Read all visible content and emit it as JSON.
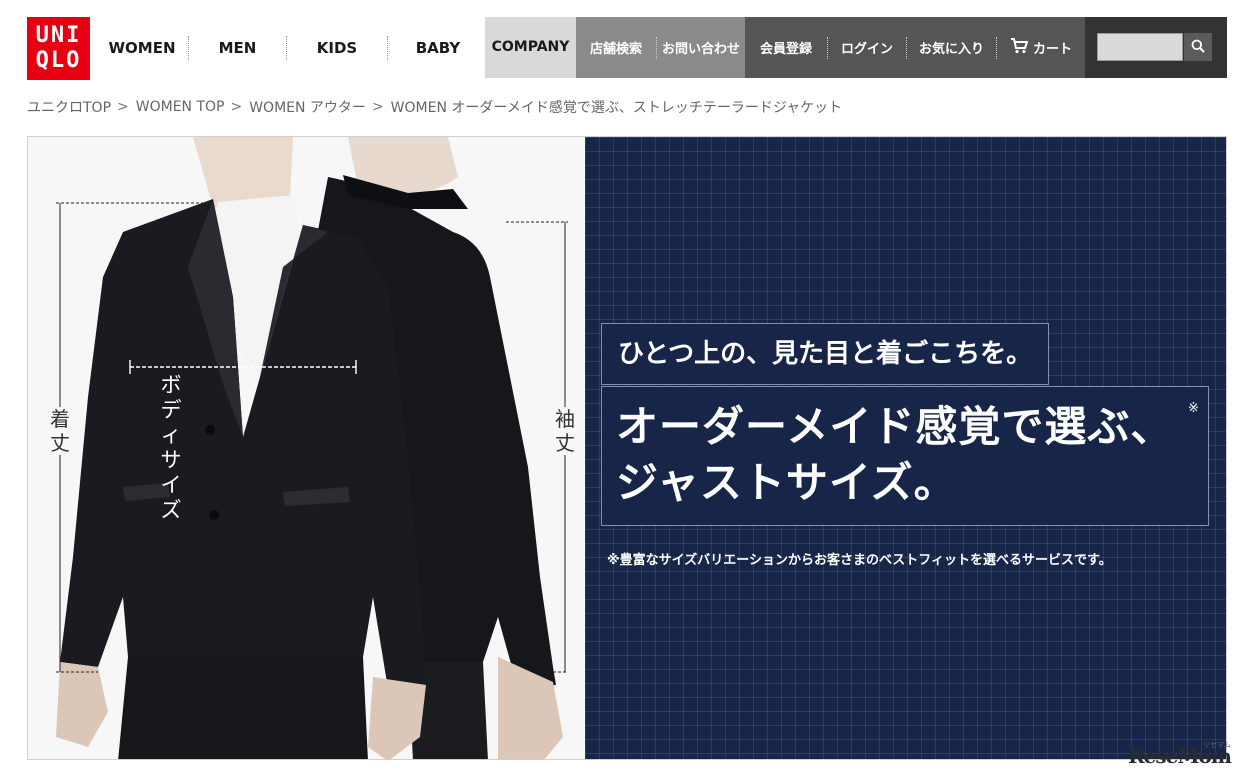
{
  "header": {
    "logo": {
      "line1": "UNI",
      "line2": "QLO"
    },
    "nav": [
      {
        "label": "WOMEN"
      },
      {
        "label": "MEN"
      },
      {
        "label": "KIDS"
      },
      {
        "label": "BABY"
      }
    ],
    "company_label": "COMPANY",
    "store_search_label": "店舗検索",
    "contact_label": "お問い合わせ",
    "register_label": "会員登録",
    "login_label": "ログイン",
    "favorites_label": "お気に入り",
    "cart_label": "カート",
    "search": {
      "placeholder": ""
    }
  },
  "breadcrumb": [
    {
      "label": "ユニクロTOP"
    },
    {
      "label": "WOMEN TOP"
    },
    {
      "label": "WOMEN アウター"
    }
  ],
  "breadcrumb_separator": ">",
  "breadcrumb_current": "WOMEN オーダーメイド感覚で選ぶ、ストレッチテーラードジャケット",
  "hero": {
    "labels": {
      "body_size": "ボディサイズ",
      "length": "着丈",
      "sleeve_length": "袖丈"
    },
    "tagline": "ひとつ上の、見た目と着ごこちを。",
    "headline_line1": "オーダーメイド感覚で選ぶ、",
    "headline_line2": "ジャストサイズ。",
    "asterisk": "※",
    "footnote": "※豊富なサイズバリエーションからお客さまのベストフィットを選べるサービスです。"
  },
  "watermark": {
    "text": "ResеMom",
    "sub": "リセマム"
  },
  "colors": {
    "logo_red": "#e60012",
    "panel_navy": "#172549",
    "company_bg": "#d9d9d9",
    "grey_block": "#8a8a8a",
    "dark_block": "#555555",
    "search_block": "#333333"
  },
  "icons": [
    "cart-icon",
    "search-icon"
  ]
}
